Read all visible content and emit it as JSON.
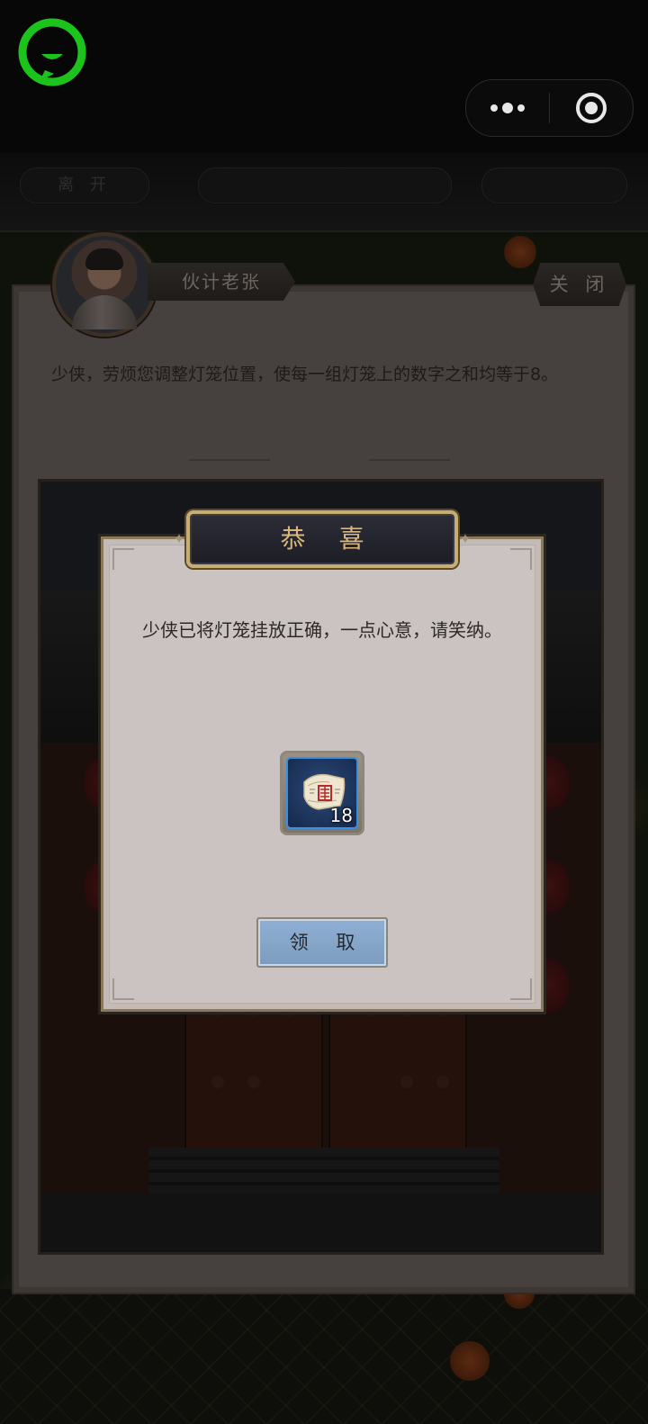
{
  "topbar": {
    "logo_icon": "chat-bubble-logo-icon",
    "more_icon": "more-dots-icon",
    "target_icon": "target-circle-icon"
  },
  "background_header": {
    "leave_label": "离 开",
    "center_label": "",
    "right_label": ""
  },
  "dialog": {
    "npc_name": "伙计老张",
    "close_label": "关 闭",
    "instruction": "少侠，劳烦您调整灯笼位置，使每一组灯笼上的数字之和均等于8。"
  },
  "reward_modal": {
    "title": "恭 喜",
    "message": "少侠已将灯笼挂放正确，一点心意，请笑纳。",
    "item": {
      "icon": "scroll-icon",
      "count": "18"
    },
    "claim_label": "领 取"
  },
  "colors": {
    "accent_green": "#1dc31d",
    "title_gold": "#d9b77c",
    "button_blue": "#8fb0d4",
    "item_border_blue": "#3a8ee0"
  }
}
